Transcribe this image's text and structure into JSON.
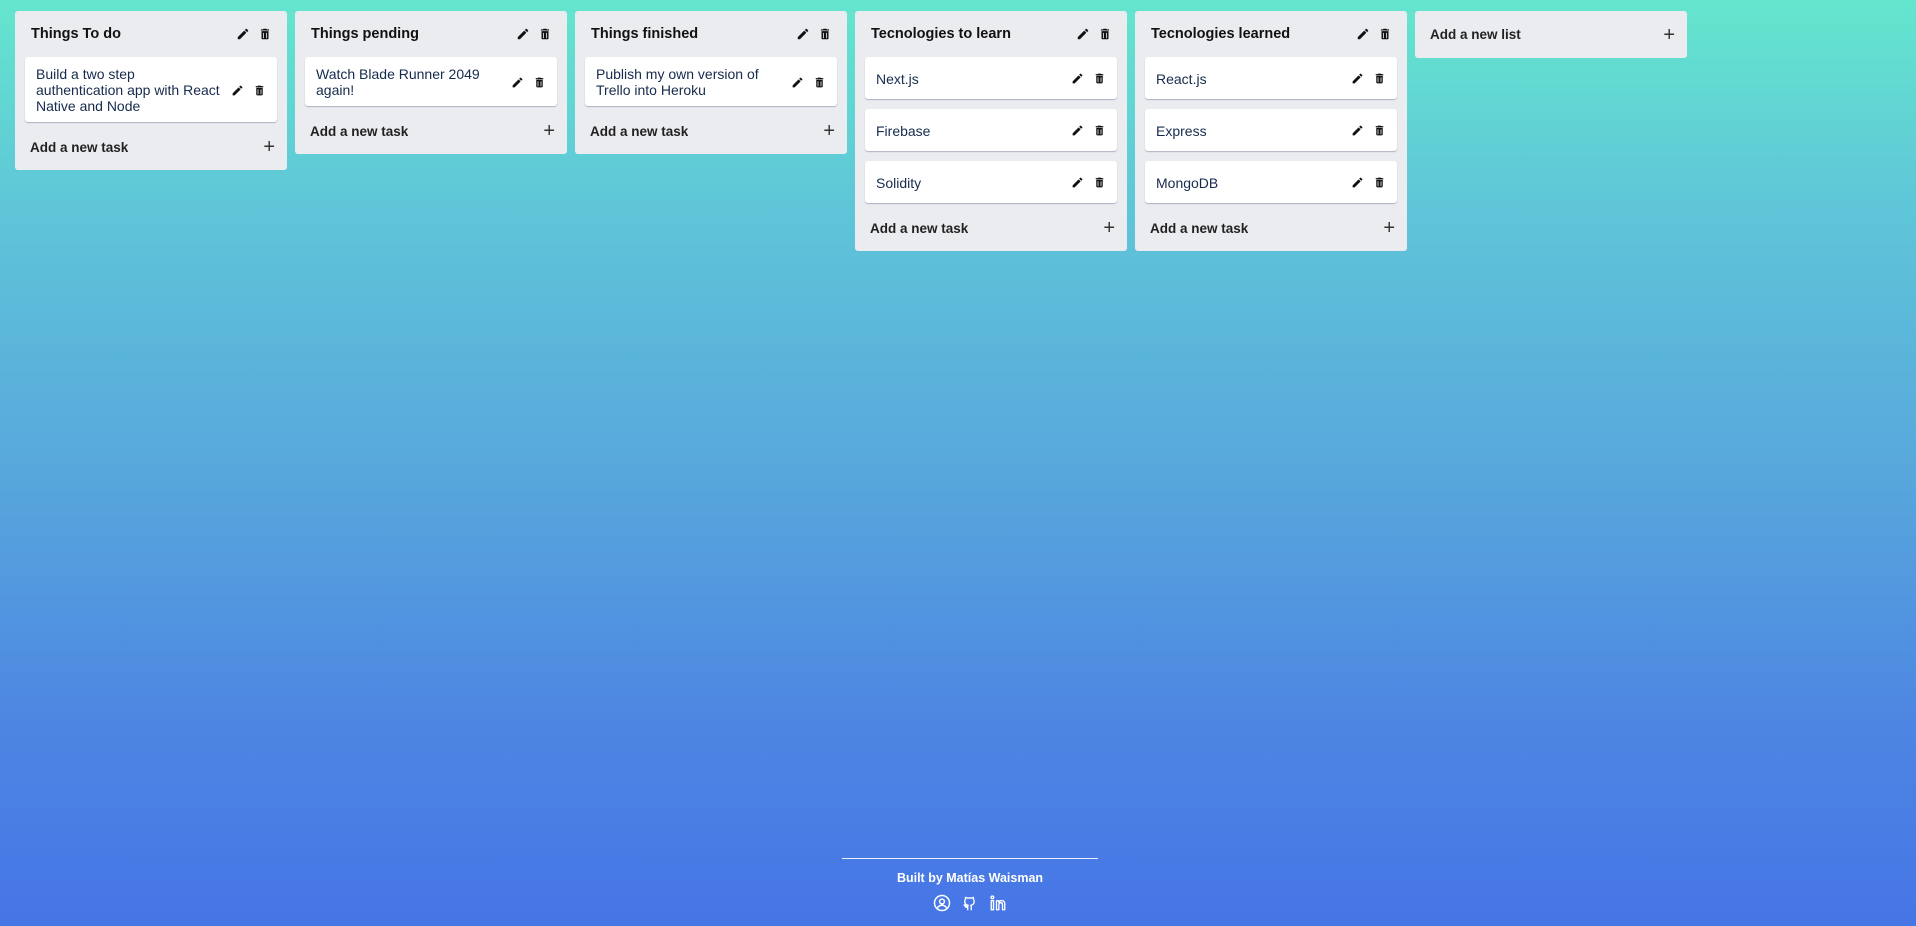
{
  "lists": [
    {
      "title": "Things To do",
      "tasks": [
        "Build a two step authentication app with React Native and Node"
      ],
      "add_task_label": "Add a new task"
    },
    {
      "title": "Things pending",
      "tasks": [
        "Watch Blade Runner 2049 again!"
      ],
      "add_task_label": "Add a new task"
    },
    {
      "title": "Things finished",
      "tasks": [
        "Publish my own version of Trello into Heroku"
      ],
      "add_task_label": "Add a new task"
    },
    {
      "title": "Tecnologies to learn",
      "tasks": [
        "Next.js",
        "Firebase",
        "Solidity"
      ],
      "add_task_label": "Add a new task"
    },
    {
      "title": "Tecnologies learned",
      "tasks": [
        "React.js",
        "Express",
        "MongoDB"
      ],
      "add_task_label": "Add a new task"
    }
  ],
  "add_list": {
    "label": "Add a new list",
    "icon": "plus-icon"
  },
  "icons": {
    "edit": "pencil-icon",
    "delete": "trash-icon",
    "add": "plus-icon"
  },
  "footer": {
    "credit": "Built by Matías Waisman",
    "links": [
      "portfolio-icon",
      "github-icon",
      "linkedin-icon"
    ]
  },
  "colors": {
    "background_top": "#64e6cd",
    "background_bottom": "#4675e6",
    "list_bg": "#ebecf0",
    "card_bg": "#ffffff"
  }
}
